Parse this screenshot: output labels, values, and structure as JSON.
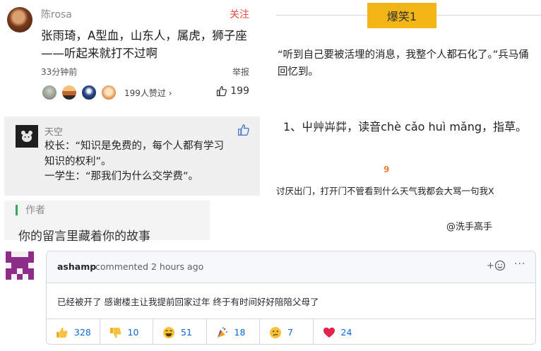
{
  "comment": {
    "author": "陈rosa",
    "follow": "关注",
    "body": "张雨琦，A型血，山东人，属虎，狮子座——听起来就打不过啊",
    "time": "33分钟前",
    "report": "举报",
    "likes_text": "199人赞过 ›",
    "thumb_count": "199"
  },
  "sky_comment": {
    "author": "天空",
    "line1": "校长：“知识是免费的，每个人都有学习",
    "line2": "知识的权利”。",
    "line3": "一学生：“那我们为什么交学费”。"
  },
  "author_note": {
    "label": "作者",
    "body": "你的留言里藏着你的故事"
  },
  "joke_panel": {
    "tag": "爆笑1",
    "quote": "“听到自己要被活埋的消息，我整个人都石化了。”兵马俑回忆到。",
    "item": "1、屮艸芔茻，读音chè cǎo huì mǎng，指草。",
    "number": "9",
    "joke": "讨厌出门，打开门不管看到什么天气我都会大骂一句我X",
    "credit": "@洗手高手"
  },
  "github": {
    "user": "ashamp",
    "action": "commented 2 hours ago",
    "react_add": "+",
    "more": "···",
    "body": "已经被开了 感谢楼主让我提前回家过年 终于有时间好好陪陪父母了",
    "reactions": [
      {
        "icon": "thumbs-up-icon",
        "count": "328"
      },
      {
        "icon": "thumbs-down-icon",
        "count": "10"
      },
      {
        "icon": "laugh-icon",
        "count": "51"
      },
      {
        "icon": "hooray-icon",
        "count": "18"
      },
      {
        "icon": "confused-icon",
        "count": "7"
      },
      {
        "icon": "heart-icon",
        "count": "24"
      }
    ],
    "colors": {
      "identicon": "#8e2c8a",
      "link": "#0969da",
      "border": "#d0d7de"
    }
  }
}
